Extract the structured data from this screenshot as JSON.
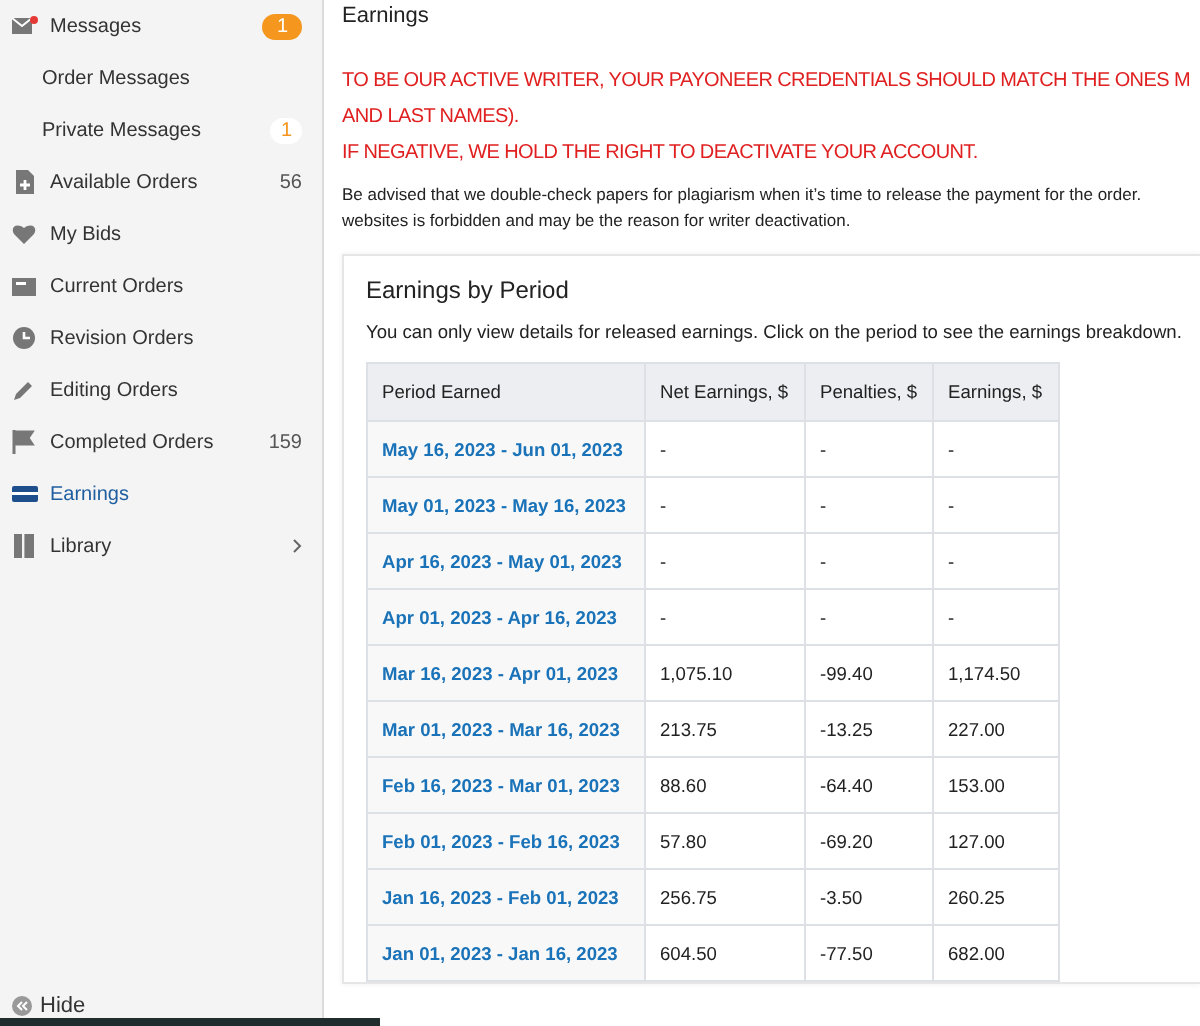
{
  "sidebar": {
    "items": [
      {
        "label": "Messages",
        "selected": false,
        "badge": {
          "kind": "pill",
          "text": "1"
        },
        "children": [
          {
            "label": "Order Messages",
            "selected": false
          },
          {
            "label": "Private Messages",
            "selected": false,
            "badge": {
              "kind": "dot",
              "text": "1"
            }
          }
        ]
      },
      {
        "label": "Available Orders",
        "selected": false,
        "badge": {
          "kind": "count",
          "text": "56"
        }
      },
      {
        "label": "My Bids",
        "selected": false
      },
      {
        "label": "Current Orders",
        "selected": false
      },
      {
        "label": "Revision Orders",
        "selected": false
      },
      {
        "label": "Editing Orders",
        "selected": false
      },
      {
        "label": "Completed Orders",
        "selected": false,
        "badge": {
          "kind": "count",
          "text": "159"
        }
      },
      {
        "label": "Earnings",
        "selected": true
      },
      {
        "label": "Library",
        "selected": false,
        "expandable": true
      }
    ],
    "hide_label": "Hide"
  },
  "page": {
    "title": "Earnings",
    "warning_lines": [
      "TO BE OUR ACTIVE WRITER, YOUR PAYONEER CREDENTIALS SHOULD MATCH THE ONES M",
      "AND LAST NAMES).",
      "IF NEGATIVE, WE HOLD THE RIGHT TO DEACTIVATE YOUR ACCOUNT."
    ],
    "notice_lines": [
      "Be advised that we double-check papers for plagiarism when it’s time to release the payment for the order.",
      "websites is forbidden and may be the reason for writer deactivation."
    ]
  },
  "earnings_card": {
    "title": "Earnings by Period",
    "hint": "You can only view details for released earnings. Click on the period to see the earnings breakdown.",
    "table": {
      "columns": [
        "Period Earned",
        "Net Earnings, $",
        "Penalties, $",
        "Earnings, $"
      ],
      "rows": [
        [
          "May 16, 2023 - Jun 01, 2023",
          "-",
          "-",
          "-"
        ],
        [
          "May 01, 2023 - May 16, 2023",
          "-",
          "-",
          "-"
        ],
        [
          "Apr 16, 2023 - May 01, 2023",
          "-",
          "-",
          "-"
        ],
        [
          "Apr 01, 2023 - Apr 16, 2023",
          "-",
          "-",
          "-"
        ],
        [
          "Mar 16, 2023 - Apr 01, 2023",
          "1,075.10",
          "-99.40",
          "1,174.50"
        ],
        [
          "Mar 01, 2023 - Mar 16, 2023",
          "213.75",
          "-13.25",
          "227.00"
        ],
        [
          "Feb 16, 2023 - Mar 01, 2023",
          "88.60",
          "-64.40",
          "153.00"
        ],
        [
          "Feb 01, 2023 - Feb 16, 2023",
          "57.80",
          "-69.20",
          "127.00"
        ],
        [
          "Jan 16, 2023 - Feb 01, 2023",
          "256.75",
          "-3.50",
          "260.25"
        ],
        [
          "Jan 01, 2023 - Jan 16, 2023",
          "604.50",
          "-77.50",
          "682.00"
        ]
      ]
    }
  }
}
